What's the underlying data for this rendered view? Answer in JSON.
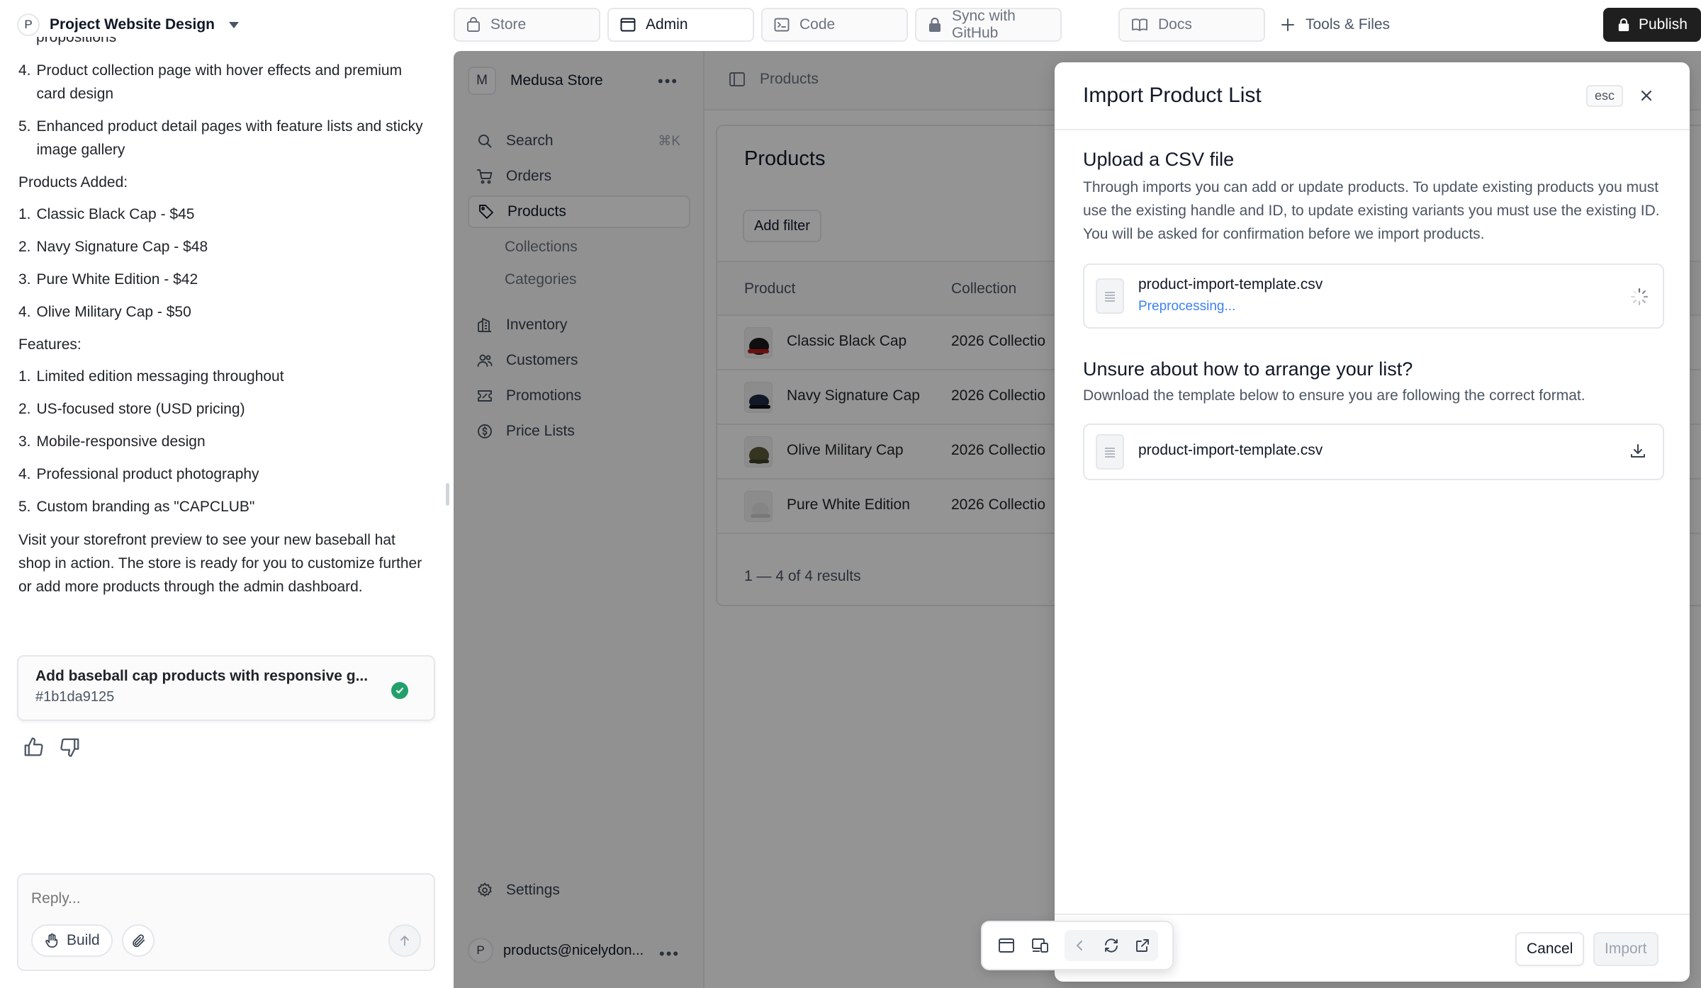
{
  "project": {
    "avatar": "P",
    "name": "Project Website Design"
  },
  "chat": {
    "cut_line": "propositions",
    "steps": [
      {
        "num": "4.",
        "text": "Product collection page with hover effects and premium card design"
      },
      {
        "num": "5.",
        "text": "Enhanced product detail pages with feature lists and sticky image gallery"
      }
    ],
    "products_heading": "Products Added:",
    "products": [
      {
        "num": "1.",
        "text": "Classic Black Cap - $45"
      },
      {
        "num": "2.",
        "text": "Navy Signature Cap - $48"
      },
      {
        "num": "3.",
        "text": "Pure White Edition - $42"
      },
      {
        "num": "4.",
        "text": "Olive Military Cap - $50"
      }
    ],
    "features_heading": "Features:",
    "features": [
      {
        "num": "1.",
        "text": "Limited edition messaging throughout"
      },
      {
        "num": "2.",
        "text": "US-focused store (USD pricing)"
      },
      {
        "num": "3.",
        "text": "Mobile-responsive design"
      },
      {
        "num": "4.",
        "text": "Professional product photography"
      },
      {
        "num": "5.",
        "text": "Custom branding as \"CAPCLUB\""
      }
    ],
    "closing": "Visit your storefront preview to see your new baseball hat shop in action. The store is ready for you to customize further or add more products through the admin dashboard.",
    "task": {
      "title": "Add baseball cap products with responsive g...",
      "id": "#1b1da9125"
    },
    "reply_placeholder": "Reply...",
    "build_label": "Build"
  },
  "toolbar": {
    "tabs": [
      {
        "label": "Store",
        "icon": "bag-icon"
      },
      {
        "label": "Admin",
        "icon": "window-icon"
      },
      {
        "label": "Code",
        "icon": "terminal-icon"
      },
      {
        "label": "Sync with GitHub",
        "icon": "lock-icon"
      },
      {
        "label": "Docs",
        "icon": "book-icon"
      }
    ],
    "tools_label": "Tools & Files",
    "publish_label": "Publish"
  },
  "admin": {
    "store_avatar": "M",
    "store_name": "Medusa Store",
    "nav": [
      {
        "label": "Search",
        "kbd": "⌘K"
      },
      {
        "label": "Orders"
      },
      {
        "label": "Products"
      },
      {
        "label": "Collections"
      },
      {
        "label": "Categories"
      },
      {
        "label": "Inventory"
      },
      {
        "label": "Customers"
      },
      {
        "label": "Promotions"
      },
      {
        "label": "Price Lists"
      }
    ],
    "settings_label": "Settings",
    "user_avatar": "P",
    "user_email": "products@nicelydon...",
    "breadcrumb": "Products",
    "products_title": "Products",
    "add_filter": "Add filter",
    "col_product": "Product",
    "col_collection": "Collection",
    "rows": [
      {
        "name": "Classic Black Cap",
        "collection": "2026 Collectio"
      },
      {
        "name": "Navy Signature Cap",
        "collection": "2026 Collectio"
      },
      {
        "name": "Olive Military Cap",
        "collection": "2026 Collectio"
      },
      {
        "name": "Pure White Edition",
        "collection": "2026 Collectio"
      }
    ],
    "count": "1 — 4 of 4 results"
  },
  "modal": {
    "title": "Import Product List",
    "esc": "esc",
    "upload_title": "Upload a CSV file",
    "upload_desc": "Through imports you can add or update products. To update existing products you must use the existing handle and ID, to update existing variants you must use the existing ID. You will be asked for confirmation before we import products.",
    "upload_file": "product-import-template.csv",
    "upload_status": "Preprocessing...",
    "template_title": "Unsure about how to arrange your list?",
    "template_desc": "Download the template below to ensure you are following the correct format.",
    "template_file": "product-import-template.csv",
    "cancel": "Cancel",
    "import": "Import"
  },
  "colors": {
    "accent": "#3b82f6",
    "success": "#22a06b",
    "publish_bg": "#1f1f1f"
  }
}
